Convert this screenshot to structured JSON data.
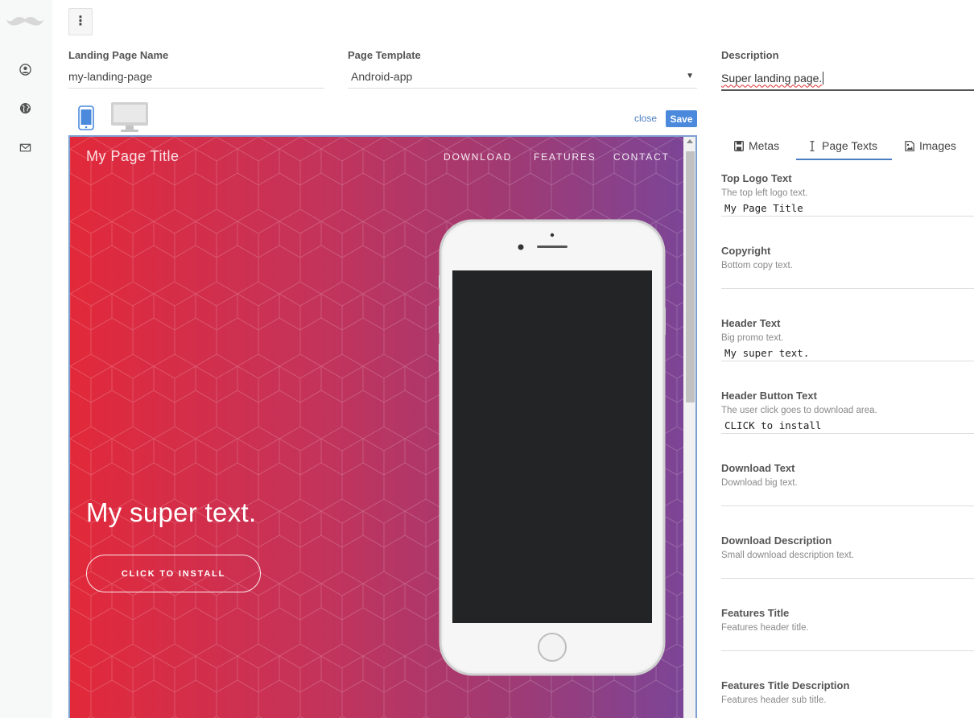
{
  "form": {
    "landing_page_name": {
      "label": "Landing Page Name",
      "value": "my-landing-page"
    },
    "page_template": {
      "label": "Page Template",
      "value": "Android-app"
    },
    "description": {
      "label": "Description",
      "value": "Super landing page."
    }
  },
  "toolbar": {
    "close_label": "close",
    "save_label": "Save"
  },
  "preview": {
    "logo_text": "My Page Title",
    "nav": [
      "DOWNLOAD",
      "FEATURES",
      "CONTACT"
    ],
    "header_text": "My super text.",
    "button_text": "CLICK TO INSTALL",
    "gradient": [
      "#e2293a",
      "#7c4596"
    ]
  },
  "tabs": [
    {
      "label": "Metas",
      "icon": "save-icon",
      "active": false
    },
    {
      "label": "Page Texts",
      "icon": "text-cursor-icon",
      "active": true
    },
    {
      "label": "Images",
      "icon": "image-icon",
      "active": false
    }
  ],
  "page_texts": [
    {
      "label": "Top Logo Text",
      "help": "The top left logo text.",
      "value": "My Page Title"
    },
    {
      "label": "Copyright",
      "help": "Bottom copy text.",
      "value": ""
    },
    {
      "label": "Header Text",
      "help": "Big promo text.",
      "value": "My super text."
    },
    {
      "label": "Header Button Text",
      "help": "The user click goes to download area.",
      "value": "CLICK to install"
    },
    {
      "label": "Download Text",
      "help": "Download big text.",
      "value": ""
    },
    {
      "label": "Download Description",
      "help": "Small download description text.",
      "value": ""
    },
    {
      "label": "Features Title",
      "help": "Features header title.",
      "value": ""
    },
    {
      "label": "Features Title Description",
      "help": "Features header sub title.",
      "value": ""
    }
  ],
  "colors": {
    "accent": "#4a89dc",
    "link": "#4a7fc1"
  }
}
